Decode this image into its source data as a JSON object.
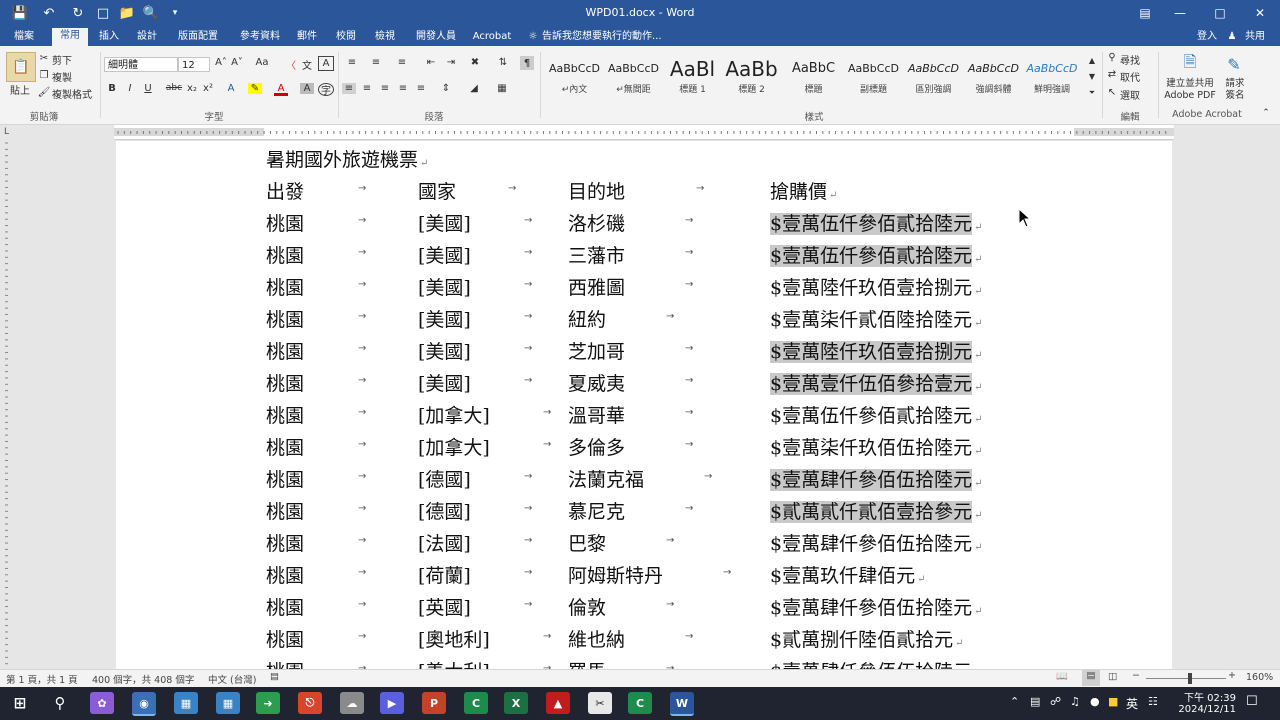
{
  "title_bar": {
    "doc_title": "WPD01.docx - Word"
  },
  "tabs": [
    "檔案",
    "常用",
    "插入",
    "設計",
    "版面配置",
    "參考資料",
    "郵件",
    "校閱",
    "檢視",
    "開發人員",
    "Acrobat"
  ],
  "active_tab": "常用",
  "tell_me": "告訴我您想要執行的動作...",
  "user": {
    "signin": "登入",
    "share": "共用"
  },
  "clipboard": {
    "paste": "貼上",
    "cut": "剪下",
    "copy": "複製",
    "format_painter": "複製格式",
    "label": "剪貼簿"
  },
  "font": {
    "name": "細明體",
    "size": "12",
    "label": "字型"
  },
  "paragraph": {
    "label": "段落"
  },
  "styles": {
    "label": "樣式",
    "items": [
      {
        "sample": "AaBbCcD",
        "name": "↵內文"
      },
      {
        "sample": "AaBbCcD",
        "name": "↵無間距"
      },
      {
        "sample": "AaBl",
        "name": "標題 1"
      },
      {
        "sample": "AaBb",
        "name": "標題 2"
      },
      {
        "sample": "AaBbC",
        "name": "標題"
      },
      {
        "sample": "AaBbCcD",
        "name": "副標題"
      },
      {
        "sample": "AaBbCcD",
        "name": "區別強調"
      },
      {
        "sample": "AaBbCcD",
        "name": "強調斜體"
      },
      {
        "sample": "AaBbCcD",
        "name": "鮮明強調"
      }
    ]
  },
  "editing": {
    "find": "尋找",
    "replace": "取代",
    "select": "選取",
    "label": "編輯"
  },
  "acrobat": {
    "create": "建立並共用 Adobe PDF",
    "sign": "請求簽名",
    "label": "Adobe Acrobat"
  },
  "document": {
    "heading": "暑期國外旅遊機票",
    "columns": [
      "出發",
      "國家",
      "目的地",
      "搶購價"
    ],
    "rows": [
      {
        "from": "桃園",
        "country": "[美國]",
        "dest": "洛杉磯",
        "price": "$壹萬伍仟參佰貳拾陸元",
        "hl": true
      },
      {
        "from": "桃園",
        "country": "[美國]",
        "dest": "三藩市",
        "price": "$壹萬伍仟參佰貳拾陸元",
        "hl": true
      },
      {
        "from": "桃園",
        "country": "[美國]",
        "dest": "西雅圖",
        "price": "$壹萬陸仟玖佰壹拾捌元",
        "hl": false
      },
      {
        "from": "桃園",
        "country": "[美國]",
        "dest": "紐約",
        "price": "$壹萬柒仟貳佰陸拾陸元",
        "hl": false
      },
      {
        "from": "桃園",
        "country": "[美國]",
        "dest": "芝加哥",
        "price": "$壹萬陸仟玖佰壹拾捌元",
        "hl": true
      },
      {
        "from": "桃園",
        "country": "[美國]",
        "dest": "夏威夷",
        "price": "$壹萬壹仟伍佰參拾壹元",
        "hl": true
      },
      {
        "from": "桃園",
        "country": "[加拿大]",
        "dest": "溫哥華",
        "price": "$壹萬伍仟參佰貳拾陸元",
        "hl": false
      },
      {
        "from": "桃園",
        "country": "[加拿大]",
        "dest": "多倫多",
        "price": "$壹萬柒仟玖佰伍拾陸元",
        "hl": false
      },
      {
        "from": "桃園",
        "country": "[德國]",
        "dest": "法蘭克福",
        "price": "$壹萬肆仟參佰伍拾陸元",
        "hl": true
      },
      {
        "from": "桃園",
        "country": "[德國]",
        "dest": "慕尼克",
        "price": "$貳萬貳仟貳佰壹拾參元",
        "hl": true
      },
      {
        "from": "桃園",
        "country": "[法國]",
        "dest": "巴黎",
        "price": "$壹萬肆仟參佰伍拾陸元",
        "hl": false
      },
      {
        "from": "桃園",
        "country": "[荷蘭]",
        "dest": "阿姆斯特丹",
        "price": "$壹萬玖仟肆佰元",
        "hl": false
      },
      {
        "from": "桃園",
        "country": "[英國]",
        "dest": "倫敦",
        "price": "$壹萬肆仟參佰伍拾陸元",
        "hl": false
      },
      {
        "from": "桃園",
        "country": "[奧地利]",
        "dest": "維也納",
        "price": "$貳萬捌仟陸佰貳拾元",
        "hl": false
      },
      {
        "from": "桃園",
        "country": "[義大利]",
        "dest": "羅馬",
        "price": "$壹萬肆仟參佰伍拾陸元",
        "hl": false
      }
    ]
  },
  "status_bar": {
    "page": "第 1 頁，共 1 頁",
    "words": "400 個字，共 408 個字",
    "language": "中文 (台灣)",
    "zoom": "160%"
  },
  "taskbar": {
    "time": "下午 02:39",
    "date": "2024/12/11",
    "ime": "英"
  },
  "colors": {
    "brand": "#2b579a",
    "highlight": "#c9c9c9"
  }
}
